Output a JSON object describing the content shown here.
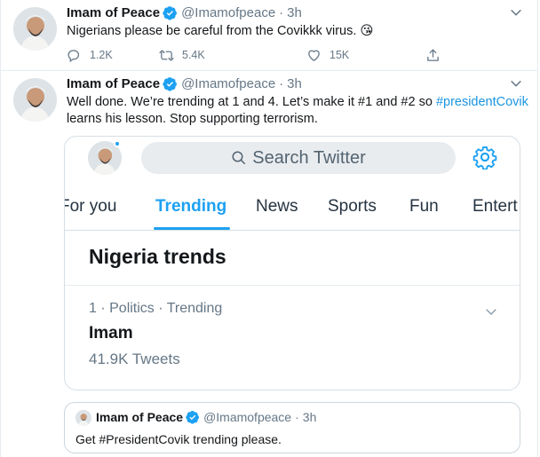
{
  "tweets": [
    {
      "name": "Imam of Peace",
      "handle": "@Imamofpeace",
      "separator": "·",
      "time": "3h",
      "text": "Nigerians please be careful from the Covikkk virus. 😘",
      "actions": {
        "replies": "1.2K",
        "retweets": "5.4K",
        "likes": "15K"
      },
      "icons": [
        "reply-icon",
        "retweet-icon",
        "like-icon",
        "share-icon"
      ]
    },
    {
      "name": "Imam of Peace",
      "handle": "@Imamofpeace",
      "separator": "·",
      "time": "3h",
      "text_line1_start": "Well done. We’re trending at 1 and 4. Let’s make it #1 and #2 so ",
      "text_hashtag": "#presidentCovik",
      "text_line2": "learns his lesson. Stop supporting terrorism.",
      "embedded_screenshot": {
        "search_placeholder": "Search Twitter",
        "tabs": [
          "For you",
          "Trending",
          "News",
          "Sports",
          "Fun",
          "Entert"
        ],
        "active_tab": "Trending",
        "section_title": "Nigeria trends",
        "trend": {
          "meta": "1 · Politics · Trending",
          "name": "Imam",
          "count": "41.9K Tweets"
        }
      },
      "quoted": {
        "name": "Imam of Peace",
        "handle": "@Imamofpeace",
        "separator": "·",
        "time": "3h",
        "text": "Get #PresidentCovik trending please."
      }
    }
  ],
  "colors": {
    "accent": "#1da1f2",
    "hashtag": "#1b95e0",
    "muted": "#657786",
    "border": "#e6ecf0"
  }
}
